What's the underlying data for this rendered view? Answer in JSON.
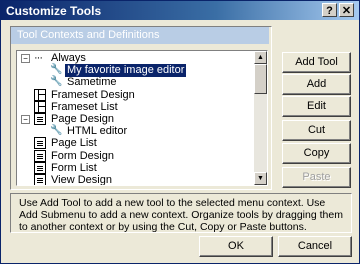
{
  "window": {
    "title": "Customize Tools",
    "help_label": "?",
    "close_label": "✕"
  },
  "group": {
    "header": "Tool Contexts and Definitions"
  },
  "tree": {
    "items": [
      {
        "label": "Always",
        "icon": "dots-icon",
        "expander": "−"
      },
      {
        "label": "My favorite image editor",
        "icon": "wrench-icon",
        "selected": true
      },
      {
        "label": "Sametime",
        "icon": "wrench-icon"
      },
      {
        "label": "Frameset Design",
        "icon": "frameset-icon"
      },
      {
        "label": "Frameset List",
        "icon": "frameset-icon"
      },
      {
        "label": "Page Design",
        "icon": "page-icon",
        "expander": "−"
      },
      {
        "label": "HTML editor",
        "icon": "wrench-icon"
      },
      {
        "label": "Page List",
        "icon": "page-icon"
      },
      {
        "label": "Form Design",
        "icon": "form-icon"
      },
      {
        "label": "Form List",
        "icon": "form-icon"
      },
      {
        "label": "View Design",
        "icon": "form-icon"
      }
    ]
  },
  "buttons": {
    "add_tool": "Add Tool",
    "add_submenu": "Add Submenu",
    "edit": "Edit",
    "cut": "Cut",
    "copy": "Copy",
    "paste": "Paste",
    "ok": "OK",
    "cancel": "Cancel"
  },
  "description": "Use Add Tool to add a new tool to the selected menu context. Use Add Submenu to add a new context. Organize tools by dragging them to another context or by using the Cut, Copy or Paste buttons."
}
